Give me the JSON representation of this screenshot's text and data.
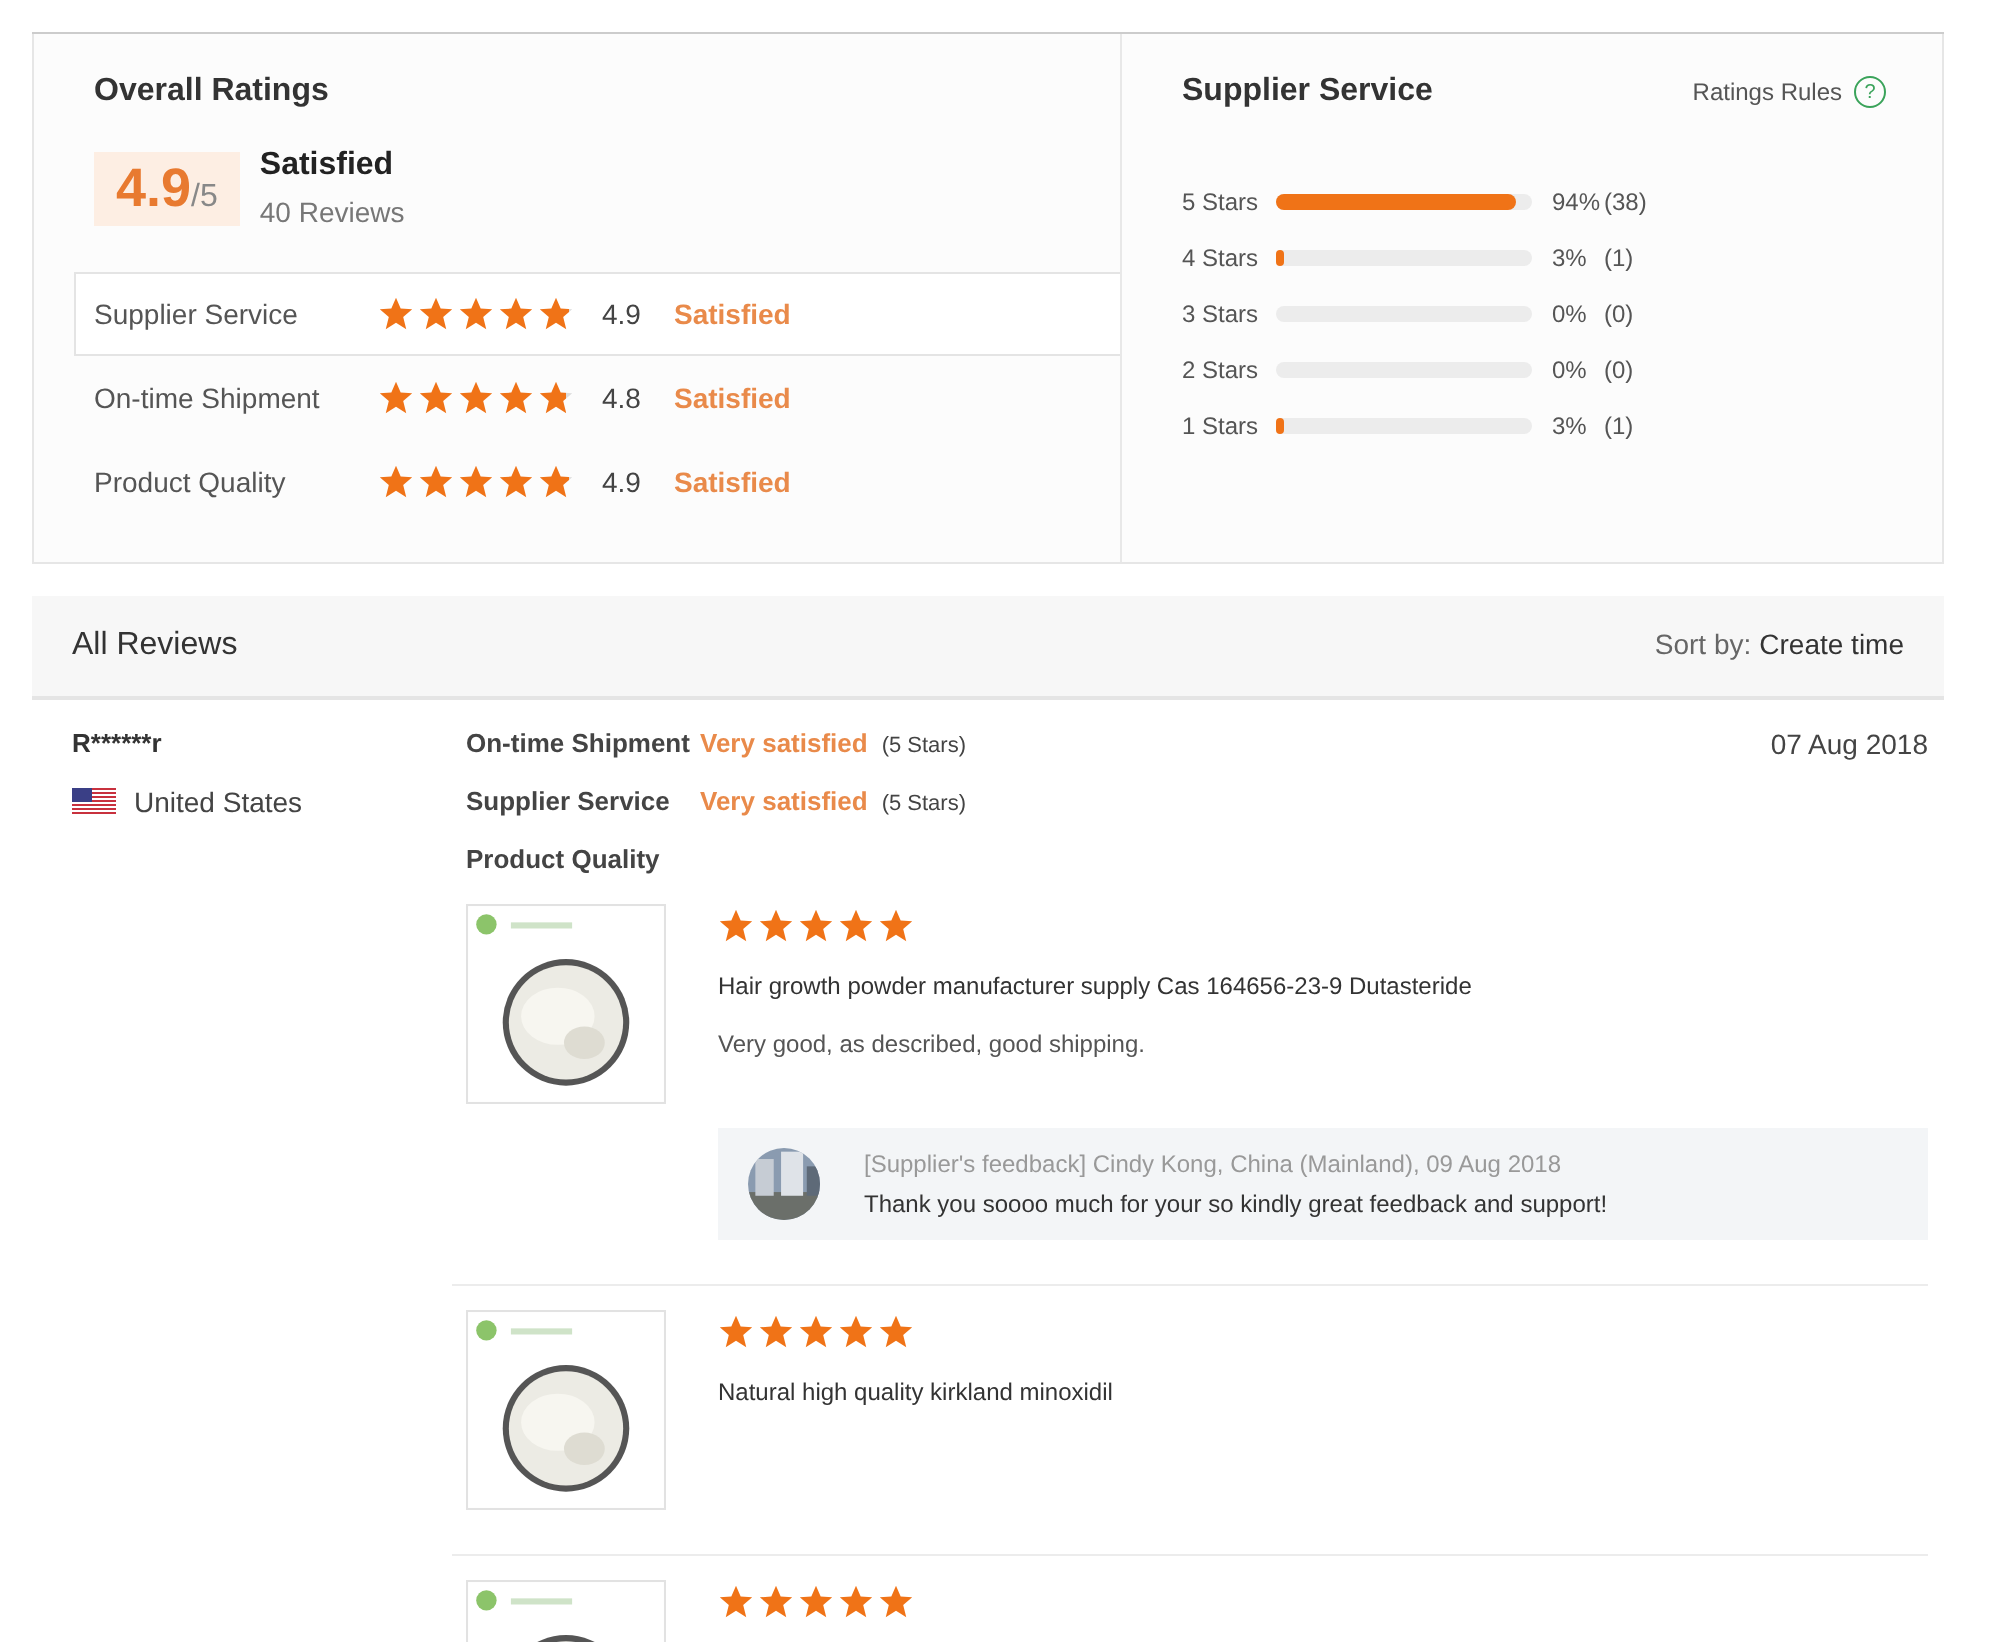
{
  "overall": {
    "title": "Overall Ratings",
    "score": "4.9",
    "out_of": "/5",
    "verdict": "Satisfied",
    "reviews": "40 Reviews",
    "categories": [
      {
        "label": "Supplier Service",
        "stars": 4.9,
        "score": "4.9",
        "verdict": "Satisfied",
        "selected": true
      },
      {
        "label": "On-time Shipment",
        "stars": 4.8,
        "score": "4.8",
        "verdict": "Satisfied",
        "selected": false
      },
      {
        "label": "Product Quality",
        "stars": 4.9,
        "score": "4.9",
        "verdict": "Satisfied",
        "selected": false
      }
    ]
  },
  "breakdown": {
    "title": "Supplier Service",
    "rules_link": "Ratings Rules",
    "help": "?",
    "rows": [
      {
        "label": "5 Stars",
        "level": 0.94,
        "percent": "94%",
        "count": "(38)"
      },
      {
        "label": "4 Stars",
        "level": 0.03,
        "percent": "3%",
        "count": "(1)"
      },
      {
        "label": "3 Stars",
        "percent": "0%",
        "count": "(0)"
      },
      {
        "label": "2 Stars",
        "percent": "0%",
        "count": "(0)"
      },
      {
        "label": "1 Stars",
        "level": 0.03,
        "percent": "3%",
        "count": "(1)"
      }
    ]
  },
  "reviews_header": {
    "title": "All Reviews",
    "sort_label": "Sort by:",
    "sort_value": "Create time"
  },
  "reviews": [
    {
      "user": "R******r",
      "country": "United States",
      "date": "07 Aug 2018",
      "ratings": [
        {
          "label": "On-time Shipment",
          "verdict": "Very satisfied",
          "stars_text": "(5 Stars)"
        },
        {
          "label": "Supplier Service",
          "verdict": "Very satisfied",
          "stars_text": "(5 Stars)"
        },
        {
          "label": "Product Quality"
        }
      ],
      "items": [
        {
          "stars": 5,
          "title": "Hair growth powder manufacturer supply Cas 164656-23-9 Dutasteride",
          "comment": "Very good, as described, good shipping.",
          "feedback": {
            "meta": "[Supplier's feedback] Cindy Kong, China (Mainland), 09 Aug 2018",
            "text": "Thank you soooo much for your so kindly great feedback and support!"
          }
        },
        {
          "stars": 5,
          "title": "Natural high quality kirkland minoxidil"
        },
        {
          "stars": 5
        }
      ]
    }
  ]
}
